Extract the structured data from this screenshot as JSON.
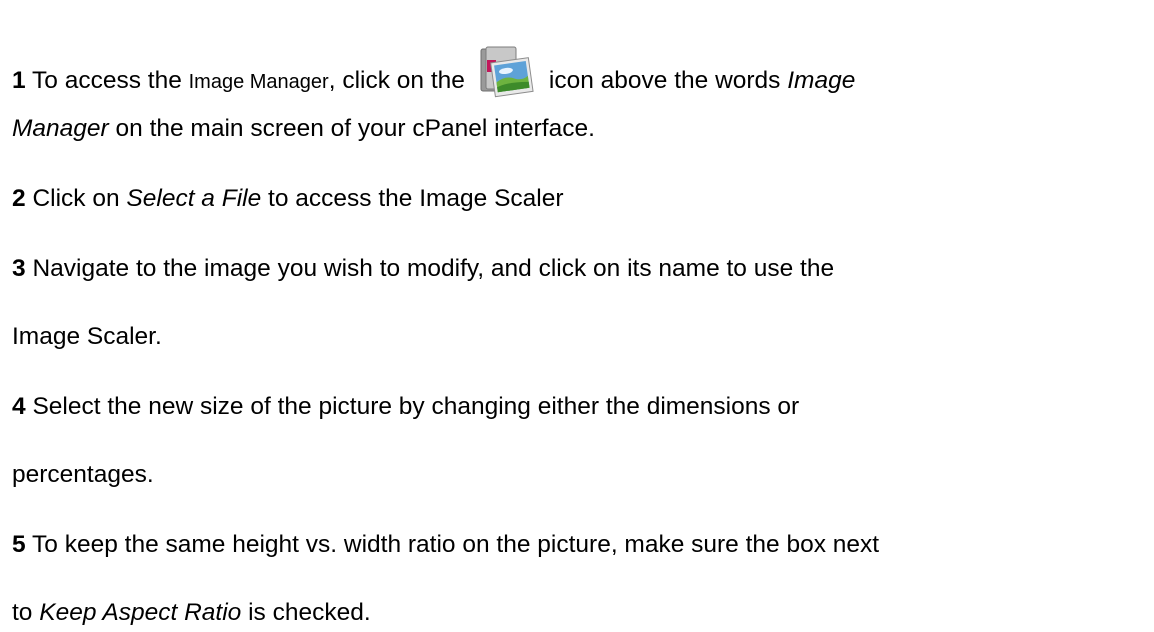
{
  "steps": [
    {
      "number": "1",
      "text_a": "To access the ",
      "text_b": "Image Manager",
      "text_c": ", click on the",
      "text_d": "icon above the words ",
      "text_e": "Image",
      "text_f": "Manager",
      "text_g": " on the main screen of your cPanel interface.",
      "icon": "image-manager-icon"
    },
    {
      "number": "2",
      "text_a": "Click on ",
      "text_b": "Select a File",
      "text_c": " to access the Image Scaler"
    },
    {
      "number": "3",
      "text_a": "Navigate to the image you wish to modify, and click on its name to use the",
      "text_b": "Image Scaler."
    },
    {
      "number": "4",
      "text_a": "Select the new size of the picture by changing either the dimensions or",
      "text_b": "percentages."
    },
    {
      "number": "5",
      "text_a": "To keep the same height vs. width ratio on the picture, make sure the box next",
      "text_b": "to ",
      "text_c": "Keep Aspect Ratio",
      "text_d": " is checked."
    }
  ]
}
